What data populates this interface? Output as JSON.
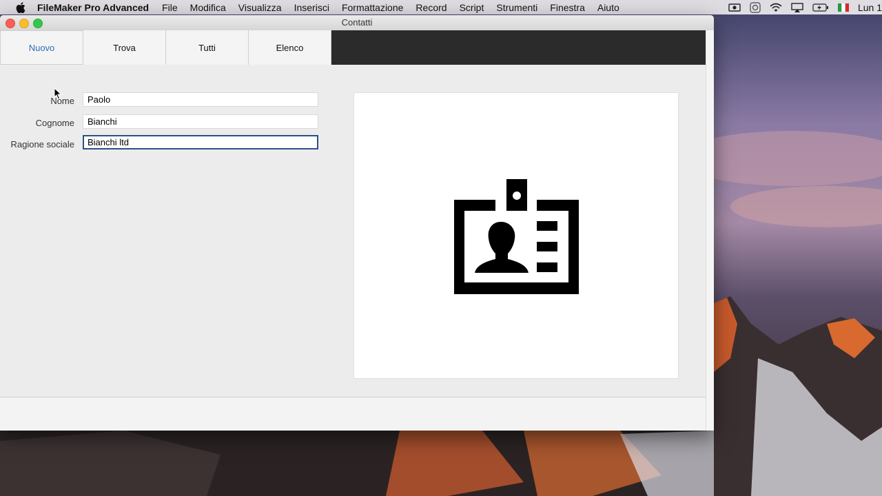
{
  "menubar": {
    "app_name": "FileMaker Pro Advanced",
    "items": [
      "File",
      "Modifica",
      "Visualizza",
      "Inserisci",
      "Formattazione",
      "Record",
      "Script",
      "Strumenti",
      "Finestra",
      "Aiuto"
    ],
    "clock": "Lun 1"
  },
  "window": {
    "title": "Contatti"
  },
  "tabs": [
    {
      "label": "Nuovo",
      "active": true
    },
    {
      "label": "Trova",
      "active": false
    },
    {
      "label": "Tutti",
      "active": false
    },
    {
      "label": "Elenco",
      "active": false
    }
  ],
  "form": {
    "nome": {
      "label": "Nome",
      "value": "Paolo"
    },
    "cognome": {
      "label": "Cognome",
      "value": "Bianchi"
    },
    "ragione_sociale": {
      "label": "Ragione sociale",
      "value": "Bianchi ltd"
    }
  },
  "colors": {
    "active_tab": "#2f6db5",
    "tab_bar": "#2b2b2b"
  },
  "icons": {
    "photo_placeholder": "id-badge-icon"
  }
}
